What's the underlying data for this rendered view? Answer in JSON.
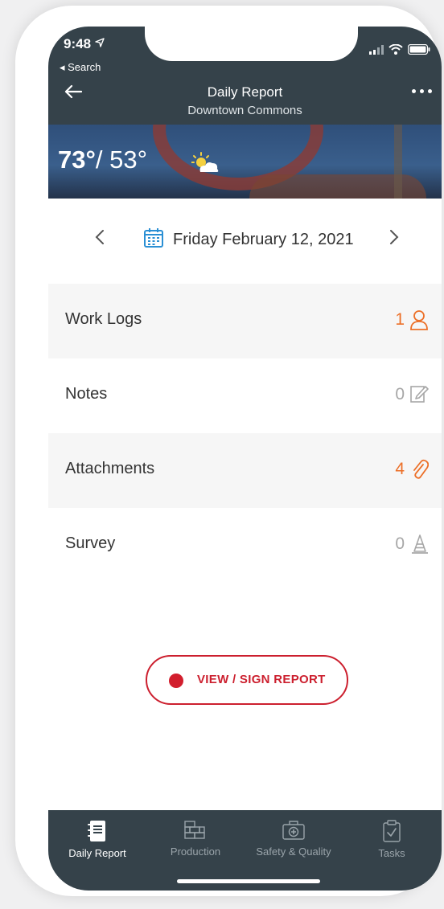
{
  "status_bar": {
    "time": "9:48",
    "back_app": "◂ Search"
  },
  "nav": {
    "title": "Daily Report",
    "subtitle": "Downtown Commons"
  },
  "weather": {
    "high": "73°",
    "low": "53°",
    "icon": "partly-sunny-icon"
  },
  "date_selector": {
    "date": "Friday February 12, 2021"
  },
  "sections": [
    {
      "label": "Work Logs",
      "count": "1",
      "icon": "person-icon",
      "color": "#ec6f27"
    },
    {
      "label": "Notes",
      "count": "0",
      "icon": "note-edit-icon",
      "color": "#a7a7a7"
    },
    {
      "label": "Attachments",
      "count": "4",
      "icon": "paperclip-icon",
      "color": "#ec6f27"
    },
    {
      "label": "Survey",
      "count": "0",
      "icon": "cone-icon",
      "color": "#a7a7a7"
    }
  ],
  "cta": {
    "label": "VIEW / SIGN REPORT",
    "color": "#cc1f2e"
  },
  "tabs": [
    {
      "label": "Daily Report",
      "icon": "notebook-icon",
      "active": true
    },
    {
      "label": "Production",
      "icon": "bricks-icon",
      "active": false
    },
    {
      "label": "Safety & Quality",
      "icon": "first-aid-icon",
      "active": false
    },
    {
      "label": "Tasks",
      "icon": "clipboard-check-icon",
      "active": false
    }
  ],
  "colors": {
    "header": "#35424a",
    "accent": "#ec6f27",
    "primary_red": "#cc1f2e",
    "calendar_blue": "#2a8fd4"
  }
}
